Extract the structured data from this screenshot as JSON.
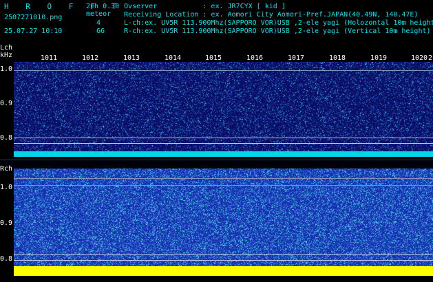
{
  "header": {
    "app_title": "H R O F F T",
    "mode": "2ch 0.30",
    "filename": "2507271010.png",
    "detect_label": "meteor",
    "timestamp": "25.07.27 10:10",
    "count_l": "4",
    "count_r": "66",
    "observer_line": "Ovserver           : ex. JR7CYX [ kid ]",
    "location_line": "Receiving Location : ex. Aomori City Aomori-Pref.JAPAN(40.49N, 140.47E)",
    "lch_line": "L-ch:ex. UV5R 113.900Mhz(SAPPORO VOR)USB ,2-ele yagi (Holozontal 10m height)",
    "rch_line": "R-ch:ex. UV5R 113.900Mhz(SAPPORO VOR)USB ,2-ele yagi (Vertical 10m height)"
  },
  "time_axis": {
    "labels": [
      "1011",
      "1012",
      "1013",
      "1014",
      "1015",
      "1016",
      "1017",
      "1018",
      "1019",
      "1020",
      "2"
    ]
  },
  "lch": {
    "title": "Lch",
    "unit": "kHz",
    "y_labels": [
      "1.0",
      "0.9",
      "0.8"
    ]
  },
  "rch": {
    "title": "Rch",
    "y_labels": [
      "1.0",
      "0.9",
      "0.8"
    ]
  },
  "colors": {
    "text": "#00e5ee",
    "lch_background": "#0a0f66",
    "rch_background": "#1630b0",
    "lch_floor": "#00d8e8",
    "rch_floor": "#ffff00"
  }
}
